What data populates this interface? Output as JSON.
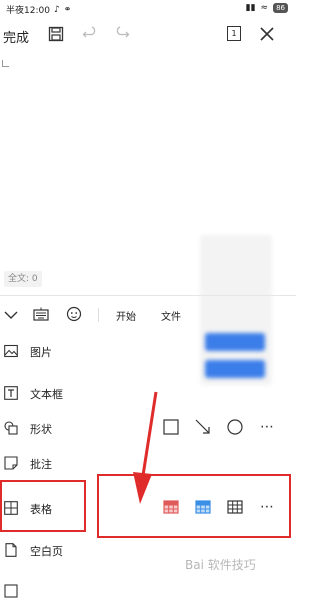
{
  "status": {
    "time": "半夜12:00",
    "battery": "86"
  },
  "toolbar": {
    "done_label": "完成",
    "page_badge": "1"
  },
  "document": {
    "word_count": "全文: 0"
  },
  "panel": {
    "tabs": [
      "开始",
      "文件"
    ]
  },
  "insert_items": [
    {
      "label": "图片"
    },
    {
      "label": "文本框"
    },
    {
      "label": "形状"
    },
    {
      "label": "批注"
    },
    {
      "label": "表格"
    },
    {
      "label": "空白页"
    }
  ],
  "colors": {
    "highlight": "#e02b2b",
    "table_red": "#e05a5a",
    "table_blue": "#3a8ee6"
  },
  "watermark": "Bai 软件技巧"
}
